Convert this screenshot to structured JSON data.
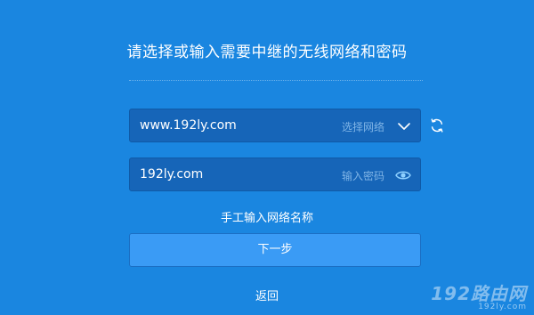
{
  "page": {
    "title": "请选择或输入需要中继的无线网络和密码"
  },
  "ssid_field": {
    "value": "www.192ly.com",
    "hint": "选择网络"
  },
  "password_field": {
    "value": "192ly.com",
    "hint": "输入密码"
  },
  "actions": {
    "manual_input_label": "手工输入网络名称",
    "next_label": "下一步",
    "back_label": "返回"
  },
  "watermark": {
    "main": "192路由网",
    "sub": "192ly.com"
  },
  "colors": {
    "background": "#1a86e0",
    "field_bg": "#1665b8",
    "button_bg": "#3a9bf5",
    "hint_text": "#7fb4e6",
    "icon_accent": "#8ed0ff"
  },
  "icons": {
    "refresh": "refresh-icon",
    "dropdown": "chevron-down-icon",
    "show_password": "eye-icon"
  }
}
